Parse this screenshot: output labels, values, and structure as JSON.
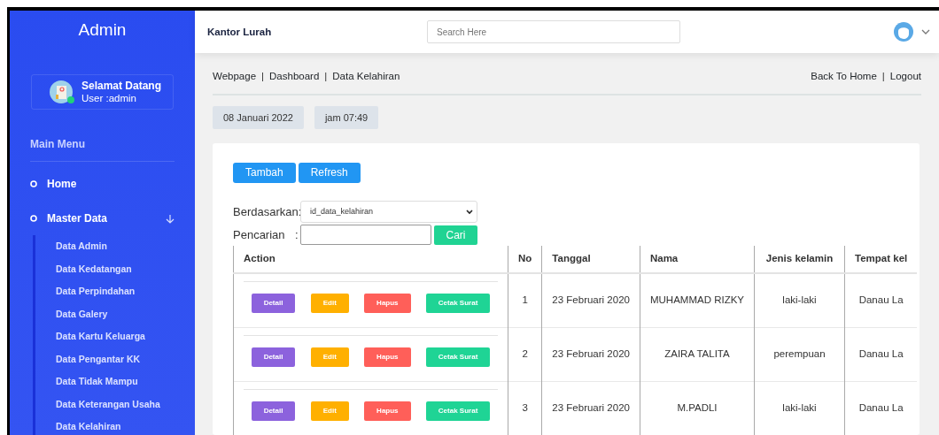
{
  "sidebar": {
    "title": "Admin",
    "user": {
      "greeting": "Selamat Datang",
      "role": "User :admin",
      "online": true
    },
    "section": "Main Menu",
    "items": [
      {
        "label": "Home"
      },
      {
        "label": "Master Data",
        "expanded": true,
        "children": [
          {
            "label": "Data Admin"
          },
          {
            "label": "Data Kedatangan"
          },
          {
            "label": "Data Perpindahan"
          },
          {
            "label": "Data Galery"
          },
          {
            "label": "Data Kartu Keluarga"
          },
          {
            "label": "Data Pengantar KK"
          },
          {
            "label": "Data Tidak Mampu"
          },
          {
            "label": "Data Keterangan Usaha"
          },
          {
            "label": "Data Kelahiran"
          }
        ]
      }
    ]
  },
  "header": {
    "title": "Kantor Lurah",
    "search": {
      "placeholder": "Search Here"
    }
  },
  "breadcrumb": {
    "items": [
      "Webpage",
      "Dashboard",
      "Data Kelahiran"
    ],
    "separator": "|",
    "links": [
      "Back To Home",
      "Logout"
    ]
  },
  "info": [
    "08 Januari 2022",
    "jam 07:49"
  ],
  "toolbar": [
    "Tambah",
    "Refresh"
  ],
  "filter": {
    "label": "Berdasarkan:",
    "value": "id_data_kelahiran",
    "search_label": "Pencarian",
    "separator": ":",
    "search_button": "Cari"
  },
  "table": {
    "action_column": "Action",
    "columns": [
      "No",
      "Tanggal",
      "Nama",
      "Jenis kelamin",
      "Tempat kel"
    ],
    "rows": [
      {
        "actions": [
          {
            "label": "Detail",
            "kind": "detail"
          },
          {
            "label": "Edit",
            "kind": "edit"
          },
          {
            "label": "Hapus",
            "kind": "delete"
          },
          {
            "label": "Cetak Surat",
            "kind": "print"
          }
        ],
        "cells": [
          "1",
          "23 Februari 2020",
          "MUHAMMAD RIZKY",
          "laki-laki",
          "Danau La"
        ]
      },
      {
        "actions": [
          {
            "label": "Detail",
            "kind": "detail"
          },
          {
            "label": "Edit",
            "kind": "edit"
          },
          {
            "label": "Hapus",
            "kind": "delete"
          },
          {
            "label": "Cetak Surat",
            "kind": "print"
          }
        ],
        "cells": [
          "2",
          "23 Februari 2020",
          "ZAIRA TALITA",
          "perempuan",
          "Danau La"
        ]
      },
      {
        "actions": [
          {
            "label": "Detail",
            "kind": "detail"
          },
          {
            "label": "Edit",
            "kind": "edit"
          },
          {
            "label": "Hapus",
            "kind": "delete"
          },
          {
            "label": "Cetak Surat",
            "kind": "print"
          }
        ],
        "cells": [
          "3",
          "23 Februari 2020",
          "M.PADLI",
          "laki-laki",
          "Danau La"
        ]
      }
    ]
  }
}
